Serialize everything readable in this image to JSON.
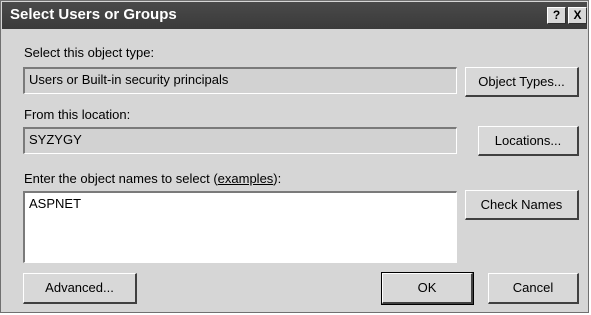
{
  "window": {
    "title": "Select Users or Groups",
    "help_button": "?",
    "close_button": "X"
  },
  "object_type": {
    "label": "Select this object type:",
    "value": "Users or Built-in security principals",
    "button_label": "Object Types..."
  },
  "location": {
    "label": "From this location:",
    "value": "SYZYGY",
    "button_label": "Locations..."
  },
  "object_names": {
    "label_prefix": "Enter the object names to select (",
    "label_link": "examples",
    "label_suffix": "):",
    "value": "ASPNET",
    "check_names_label": "Check Names"
  },
  "footer": {
    "advanced_label": "Advanced...",
    "ok_label": "OK",
    "cancel_label": "Cancel"
  }
}
